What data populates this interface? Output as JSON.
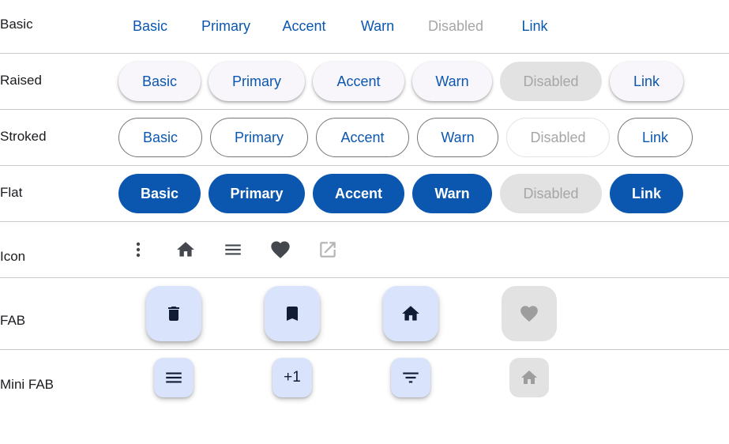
{
  "rows": {
    "basic": {
      "label": "Basic",
      "buttons": [
        "Basic",
        "Primary",
        "Accent",
        "Warn",
        "Disabled",
        "Link"
      ]
    },
    "raised": {
      "label": "Raised",
      "buttons": [
        "Basic",
        "Primary",
        "Accent",
        "Warn",
        "Disabled",
        "Link"
      ]
    },
    "stroked": {
      "label": "Stroked",
      "buttons": [
        "Basic",
        "Primary",
        "Accent",
        "Warn",
        "Disabled",
        "Link"
      ]
    },
    "flat": {
      "label": "Flat",
      "buttons": [
        "Basic",
        "Primary",
        "Accent",
        "Warn",
        "Disabled",
        "Link"
      ]
    },
    "icon": {
      "label": "Icon",
      "icons": [
        "more-vert-icon",
        "home-icon",
        "menu-icon",
        "favorite-icon",
        "open-in-new-icon"
      ]
    },
    "fab": {
      "label": "FAB",
      "icons": [
        "delete-icon",
        "bookmark-icon",
        "home-icon",
        "favorite-icon"
      ]
    },
    "mini_fab": {
      "label": "Mini FAB",
      "icons": [
        "menu-icon",
        "plus-one-icon",
        "filter-list-icon",
        "home-icon"
      ],
      "plus_one_text": "+1"
    }
  },
  "colors": {
    "primary": "#0b57b0",
    "disabled_text": "#a6a6a6",
    "disabled_bg": "#e2e2e2",
    "fab_bg": "#d9e3fc",
    "icon": "#44474e"
  }
}
